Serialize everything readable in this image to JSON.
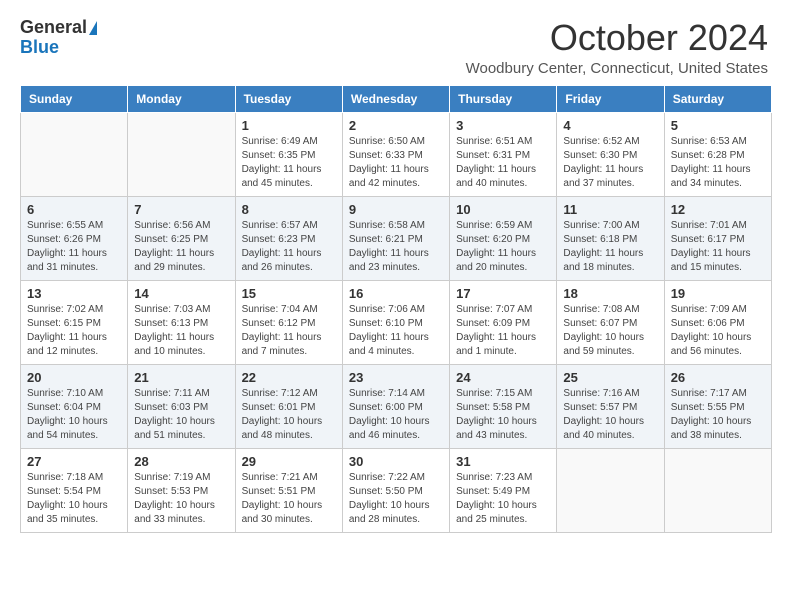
{
  "header": {
    "logo_general": "General",
    "logo_blue": "Blue",
    "month_title": "October 2024",
    "location": "Woodbury Center, Connecticut, United States"
  },
  "weekdays": [
    "Sunday",
    "Monday",
    "Tuesday",
    "Wednesday",
    "Thursday",
    "Friday",
    "Saturday"
  ],
  "weeks": [
    [
      {
        "day": "",
        "info": ""
      },
      {
        "day": "",
        "info": ""
      },
      {
        "day": "1",
        "info": "Sunrise: 6:49 AM\nSunset: 6:35 PM\nDaylight: 11 hours and 45 minutes."
      },
      {
        "day": "2",
        "info": "Sunrise: 6:50 AM\nSunset: 6:33 PM\nDaylight: 11 hours and 42 minutes."
      },
      {
        "day": "3",
        "info": "Sunrise: 6:51 AM\nSunset: 6:31 PM\nDaylight: 11 hours and 40 minutes."
      },
      {
        "day": "4",
        "info": "Sunrise: 6:52 AM\nSunset: 6:30 PM\nDaylight: 11 hours and 37 minutes."
      },
      {
        "day": "5",
        "info": "Sunrise: 6:53 AM\nSunset: 6:28 PM\nDaylight: 11 hours and 34 minutes."
      }
    ],
    [
      {
        "day": "6",
        "info": "Sunrise: 6:55 AM\nSunset: 6:26 PM\nDaylight: 11 hours and 31 minutes."
      },
      {
        "day": "7",
        "info": "Sunrise: 6:56 AM\nSunset: 6:25 PM\nDaylight: 11 hours and 29 minutes."
      },
      {
        "day": "8",
        "info": "Sunrise: 6:57 AM\nSunset: 6:23 PM\nDaylight: 11 hours and 26 minutes."
      },
      {
        "day": "9",
        "info": "Sunrise: 6:58 AM\nSunset: 6:21 PM\nDaylight: 11 hours and 23 minutes."
      },
      {
        "day": "10",
        "info": "Sunrise: 6:59 AM\nSunset: 6:20 PM\nDaylight: 11 hours and 20 minutes."
      },
      {
        "day": "11",
        "info": "Sunrise: 7:00 AM\nSunset: 6:18 PM\nDaylight: 11 hours and 18 minutes."
      },
      {
        "day": "12",
        "info": "Sunrise: 7:01 AM\nSunset: 6:17 PM\nDaylight: 11 hours and 15 minutes."
      }
    ],
    [
      {
        "day": "13",
        "info": "Sunrise: 7:02 AM\nSunset: 6:15 PM\nDaylight: 11 hours and 12 minutes."
      },
      {
        "day": "14",
        "info": "Sunrise: 7:03 AM\nSunset: 6:13 PM\nDaylight: 11 hours and 10 minutes."
      },
      {
        "day": "15",
        "info": "Sunrise: 7:04 AM\nSunset: 6:12 PM\nDaylight: 11 hours and 7 minutes."
      },
      {
        "day": "16",
        "info": "Sunrise: 7:06 AM\nSunset: 6:10 PM\nDaylight: 11 hours and 4 minutes."
      },
      {
        "day": "17",
        "info": "Sunrise: 7:07 AM\nSunset: 6:09 PM\nDaylight: 11 hours and 1 minute."
      },
      {
        "day": "18",
        "info": "Sunrise: 7:08 AM\nSunset: 6:07 PM\nDaylight: 10 hours and 59 minutes."
      },
      {
        "day": "19",
        "info": "Sunrise: 7:09 AM\nSunset: 6:06 PM\nDaylight: 10 hours and 56 minutes."
      }
    ],
    [
      {
        "day": "20",
        "info": "Sunrise: 7:10 AM\nSunset: 6:04 PM\nDaylight: 10 hours and 54 minutes."
      },
      {
        "day": "21",
        "info": "Sunrise: 7:11 AM\nSunset: 6:03 PM\nDaylight: 10 hours and 51 minutes."
      },
      {
        "day": "22",
        "info": "Sunrise: 7:12 AM\nSunset: 6:01 PM\nDaylight: 10 hours and 48 minutes."
      },
      {
        "day": "23",
        "info": "Sunrise: 7:14 AM\nSunset: 6:00 PM\nDaylight: 10 hours and 46 minutes."
      },
      {
        "day": "24",
        "info": "Sunrise: 7:15 AM\nSunset: 5:58 PM\nDaylight: 10 hours and 43 minutes."
      },
      {
        "day": "25",
        "info": "Sunrise: 7:16 AM\nSunset: 5:57 PM\nDaylight: 10 hours and 40 minutes."
      },
      {
        "day": "26",
        "info": "Sunrise: 7:17 AM\nSunset: 5:55 PM\nDaylight: 10 hours and 38 minutes."
      }
    ],
    [
      {
        "day": "27",
        "info": "Sunrise: 7:18 AM\nSunset: 5:54 PM\nDaylight: 10 hours and 35 minutes."
      },
      {
        "day": "28",
        "info": "Sunrise: 7:19 AM\nSunset: 5:53 PM\nDaylight: 10 hours and 33 minutes."
      },
      {
        "day": "29",
        "info": "Sunrise: 7:21 AM\nSunset: 5:51 PM\nDaylight: 10 hours and 30 minutes."
      },
      {
        "day": "30",
        "info": "Sunrise: 7:22 AM\nSunset: 5:50 PM\nDaylight: 10 hours and 28 minutes."
      },
      {
        "day": "31",
        "info": "Sunrise: 7:23 AM\nSunset: 5:49 PM\nDaylight: 10 hours and 25 minutes."
      },
      {
        "day": "",
        "info": ""
      },
      {
        "day": "",
        "info": ""
      }
    ]
  ]
}
